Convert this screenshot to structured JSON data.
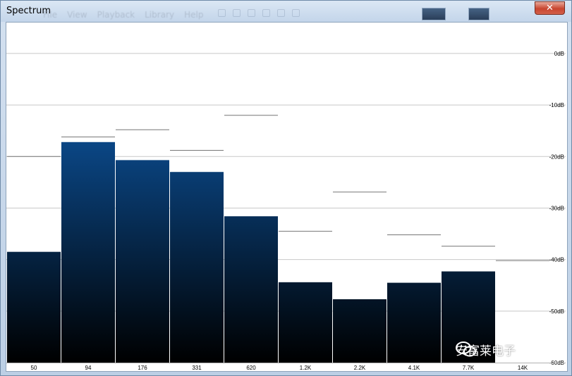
{
  "window": {
    "title": "Spectrum",
    "close_glyph": "✕",
    "background_menu": [
      "File",
      "View",
      "Playback",
      "Library",
      "Help"
    ]
  },
  "colors": {
    "bar_top": "#0b4a8c",
    "bar_bottom": "#000000",
    "grid": "#c8c8c8",
    "peak": "#777777",
    "axis_text": "#000000"
  },
  "chart_data": {
    "type": "bar",
    "categories": [
      "50",
      "94",
      "176",
      "331",
      "620",
      "1.2K",
      "2.2K",
      "4.1K",
      "7.7K",
      "14K"
    ],
    "series": [
      {
        "values": [
          -38.5,
          -17.2,
          -20.7,
          -23.0,
          -31.6,
          -44.4,
          -47.7,
          -44.5,
          -42.3,
          null
        ]
      }
    ],
    "peaks": [
      -20.0,
      -16.2,
      -14.8,
      -18.8,
      -12.0,
      -34.5,
      -26.9,
      -35.2,
      -37.4,
      -40.2
    ],
    "ylim": [
      -60,
      6
    ],
    "y_ticks": [
      0,
      -10,
      -20,
      -30,
      -40,
      -50,
      -60
    ],
    "y_tick_labels": [
      "0dB",
      "-10dB",
      "-20dB",
      "-30dB",
      "-40dB",
      "-50dB",
      "-60dB"
    ],
    "grid": true,
    "title": "",
    "xlabel": "",
    "ylabel": ""
  },
  "watermark": {
    "icon": "wechat-icon",
    "text": "安富莱电子"
  }
}
